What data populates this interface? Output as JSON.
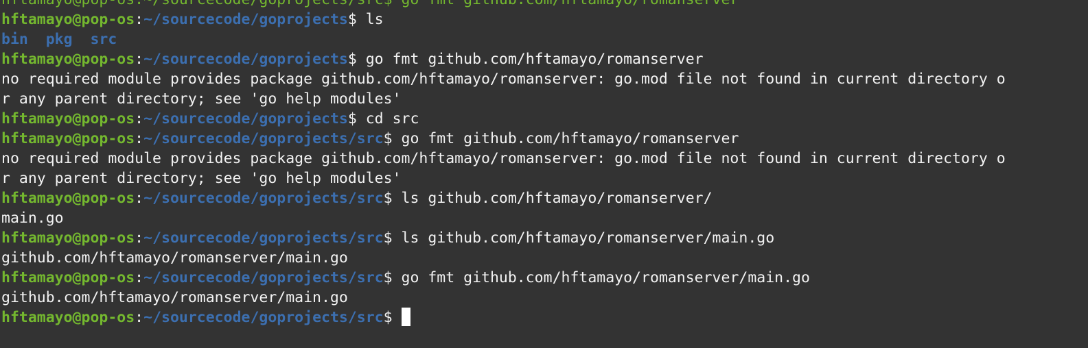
{
  "theme": {
    "background": "#333333",
    "foreground": "#f2f2f2",
    "prompt_user_color": "#74b82f",
    "prompt_path_color": "#3c6fb0"
  },
  "terminal": {
    "top_partial": "hftamayo@pop-os:~/sourcecode/goprojects/src$ go fmt github.com/hftamayo/romanserver",
    "lines": [
      {
        "type": "prompt",
        "user": "hftamayo@pop-os",
        "path": "~/sourcecode/goprojects",
        "command": "ls"
      },
      {
        "type": "dirs",
        "items": [
          "bin",
          "pkg",
          "src"
        ]
      },
      {
        "type": "prompt",
        "user": "hftamayo@pop-os",
        "path": "~/sourcecode/goprojects",
        "command": "go fmt github.com/hftamayo/romanserver"
      },
      {
        "type": "output",
        "text": "no required module provides package github.com/hftamayo/romanserver: go.mod file not found in current directory o"
      },
      {
        "type": "output",
        "text": "r any parent directory; see 'go help modules'"
      },
      {
        "type": "prompt",
        "user": "hftamayo@pop-os",
        "path": "~/sourcecode/goprojects",
        "command": "cd src"
      },
      {
        "type": "prompt",
        "user": "hftamayo@pop-os",
        "path": "~/sourcecode/goprojects/src",
        "command": "go fmt github.com/hftamayo/romanserver"
      },
      {
        "type": "output",
        "text": "no required module provides package github.com/hftamayo/romanserver: go.mod file not found in current directory o"
      },
      {
        "type": "output",
        "text": "r any parent directory; see 'go help modules'"
      },
      {
        "type": "prompt",
        "user": "hftamayo@pop-os",
        "path": "~/sourcecode/goprojects/src",
        "command": "ls github.com/hftamayo/romanserver/"
      },
      {
        "type": "output",
        "text": "main.go"
      },
      {
        "type": "prompt",
        "user": "hftamayo@pop-os",
        "path": "~/sourcecode/goprojects/src",
        "command": "ls github.com/hftamayo/romanserver/main.go"
      },
      {
        "type": "output",
        "text": "github.com/hftamayo/romanserver/main.go"
      },
      {
        "type": "prompt",
        "user": "hftamayo@pop-os",
        "path": "~/sourcecode/goprojects/src",
        "command": "go fmt github.com/hftamayo/romanserver/main.go"
      },
      {
        "type": "output",
        "text": "github.com/hftamayo/romanserver/main.go"
      },
      {
        "type": "prompt",
        "user": "hftamayo@pop-os",
        "path": "~/sourcecode/goprojects/src",
        "command": "",
        "cursor": true
      }
    ]
  }
}
